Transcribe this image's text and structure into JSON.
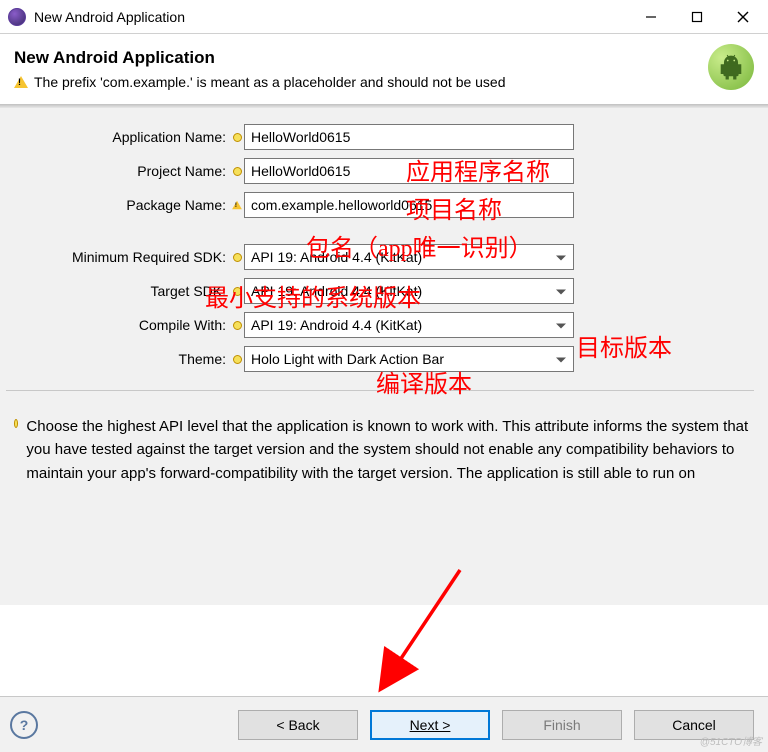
{
  "window": {
    "title": "New Android Application"
  },
  "banner": {
    "heading": "New Android Application",
    "warning": "The prefix 'com.example.' is meant as a placeholder and should not be used"
  },
  "fields": {
    "app_name_label": "Application Name:",
    "app_name_value": "HelloWorld0615",
    "project_name_label": "Project Name:",
    "project_name_value": "HelloWorld0615",
    "package_name_label": "Package Name:",
    "package_name_value": "com.example.helloworld0615",
    "min_sdk_label": "Minimum Required SDK:",
    "min_sdk_value": "API 19: Android 4.4 (KitKat)",
    "target_sdk_label": "Target SDK:",
    "target_sdk_value": "API 19: Android 4.4 (KitKat)",
    "compile_with_label": "Compile With:",
    "compile_with_value": "API 19: Android 4.4 (KitKat)",
    "theme_label": "Theme:",
    "theme_value": "Holo Light with Dark Action Bar"
  },
  "help": {
    "text": "Choose the highest API level that the application is known to work with. This attribute informs the system that you have tested against the target version and the system should not enable any compatibility behaviors to maintain your app's forward-compatibility with the target version. The application is still able to run on"
  },
  "annotations": {
    "a1": "应用程序名称",
    "a2": "项目名称",
    "a3": "包名（app唯一识别）",
    "a4": "最小支持的系统版本",
    "a5": "目标版本",
    "a6": "编译版本"
  },
  "buttons": {
    "back": "< Back",
    "next": "Next >",
    "finish": "Finish",
    "cancel": "Cancel"
  },
  "watermark": "@51CTO博客"
}
